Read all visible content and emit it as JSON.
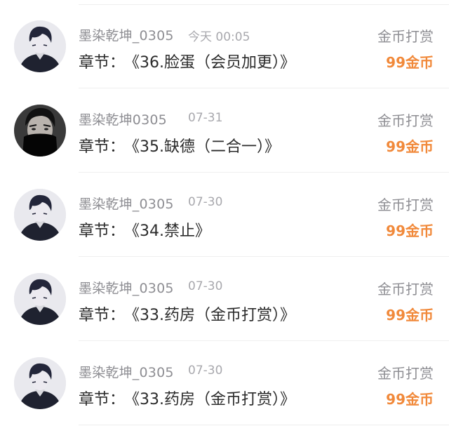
{
  "colors": {
    "reward_amount": "#f1893a",
    "secondary_text": "#8e8e93",
    "primary_text": "#2b2b2b"
  },
  "chapter_label": "章节：",
  "records": [
    {
      "username": "墨染乾坤_0305",
      "date": "今天 00:05",
      "chapter": "《36.脸蛋（会员加更）》",
      "reward_type": "金币打赏",
      "reward_amount": "99金币",
      "avatar_icon": "anime-boy-avatar-icon"
    },
    {
      "username": "墨染乾坤0305",
      "date": "07-31",
      "chapter": "《35.缺德（二合一）》",
      "reward_type": "金币打赏",
      "reward_amount": "99金币",
      "avatar_icon": "masked-man-avatar-icon"
    },
    {
      "username": "墨染乾坤_0305",
      "date": "07-30",
      "chapter": "《34.禁止》",
      "reward_type": "金币打赏",
      "reward_amount": "99金币",
      "avatar_icon": "anime-boy-avatar-icon"
    },
    {
      "username": "墨染乾坤_0305",
      "date": "07-30",
      "chapter": "《33.药房（金币打赏）》",
      "reward_type": "金币打赏",
      "reward_amount": "99金币",
      "avatar_icon": "anime-boy-avatar-icon"
    },
    {
      "username": "墨染乾坤_0305",
      "date": "07-30",
      "chapter": "《33.药房（金币打赏）》",
      "reward_type": "金币打赏",
      "reward_amount": "99金币",
      "avatar_icon": "anime-boy-avatar-icon"
    }
  ]
}
